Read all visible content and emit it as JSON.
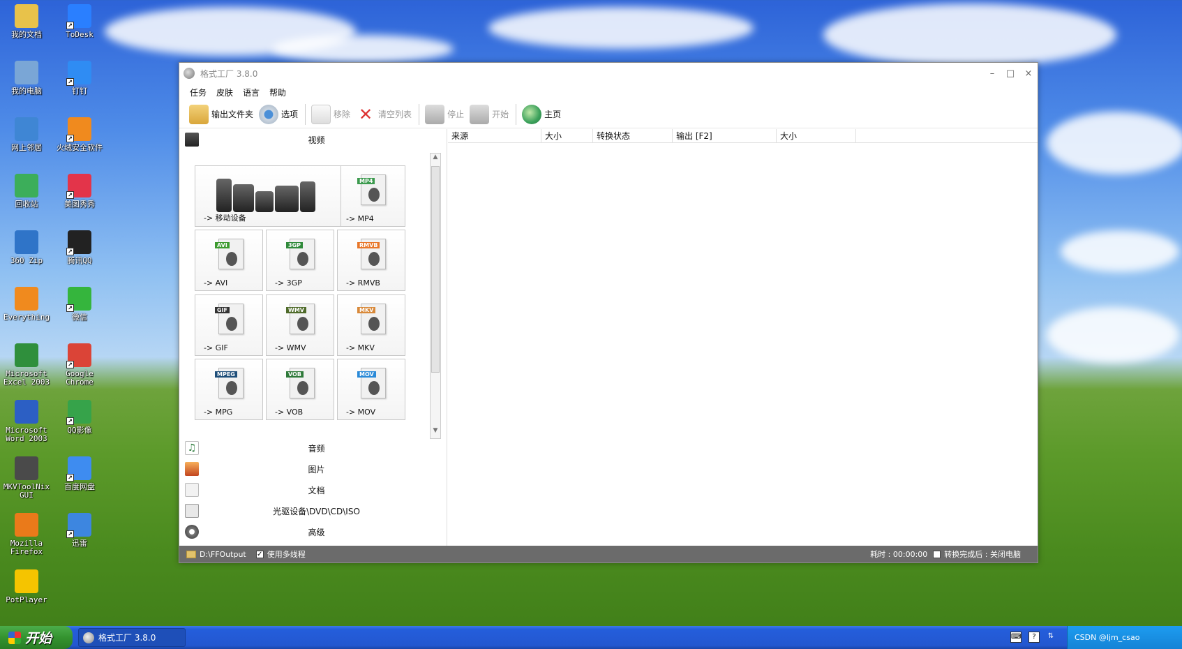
{
  "desktop": {
    "icons": [
      {
        "label": "我的文档",
        "color": "#e8c24a"
      },
      {
        "label": "ToDesk",
        "color": "#2a7fff"
      },
      {
        "label": "我的电脑",
        "color": "#7aa6d6"
      },
      {
        "label": "钉钉",
        "color": "#2f8cf3"
      },
      {
        "label": "网上邻居",
        "color": "#3f86d4"
      },
      {
        "label": "火绒安全软件",
        "color": "#f08a1e"
      },
      {
        "label": "回收站",
        "color": "#3cae5a"
      },
      {
        "label": "美图秀秀",
        "color": "#e3344a"
      },
      {
        "label": "360 Zip",
        "color": "#2f74c8"
      },
      {
        "label": "腾讯QQ",
        "color": "#222222"
      },
      {
        "label": "Everything",
        "color": "#f08a1e"
      },
      {
        "label": "微信",
        "color": "#35b53d"
      },
      {
        "label": "Microsoft\nExcel 2003",
        "color": "#2f8f3c"
      },
      {
        "label": "Google\nChrome",
        "color": "#db4437"
      },
      {
        "label": "Microsoft\nWord 2003",
        "color": "#2c5fc4"
      },
      {
        "label": "QQ影像",
        "color": "#36a34a"
      },
      {
        "label": "MKVToolNix\nGUI",
        "color": "#4a4a4a"
      },
      {
        "label": "百度网盘",
        "color": "#3e8cf0"
      },
      {
        "label": "Mozilla\nFirefox",
        "color": "#ea7a1a"
      },
      {
        "label": "迅雷",
        "color": "#3d86e0"
      },
      {
        "label": "PotPlayer",
        "color": "#f5c400"
      }
    ]
  },
  "window": {
    "title": "格式工厂 3.8.0",
    "controls": {
      "minimize": "–",
      "maximize": "□",
      "close": "×"
    },
    "menu": [
      "任务",
      "皮肤",
      "语言",
      "帮助"
    ],
    "toolbar": {
      "output_folder": "输出文件夹",
      "options": "选项",
      "remove": "移除",
      "clear_list": "清空列表",
      "stop": "停止",
      "start": "开始",
      "home": "主页"
    },
    "categories": {
      "video": "视频",
      "audio": "音频",
      "image": "图片",
      "document": "文档",
      "disc": "光驱设备\\DVD\\CD\\ISO",
      "advanced": "高级"
    },
    "formats": [
      {
        "label": "-> 移动设备",
        "tag": "",
        "tag_color": "#4a4a4a"
      },
      {
        "label": "-> MP4",
        "tag": "MP4",
        "tag_color": "#3c9a4e"
      },
      {
        "label": "-> AVI",
        "tag": "AVI",
        "tag_color": "#3c9a2e"
      },
      {
        "label": "-> 3GP",
        "tag": "3GP",
        "tag_color": "#2f8a3a"
      },
      {
        "label": "-> RMVB",
        "tag": "RMVB",
        "tag_color": "#e8772a"
      },
      {
        "label": "-> GIF",
        "tag": "GIF",
        "tag_color": "#333333"
      },
      {
        "label": "-> WMV",
        "tag": "WMV",
        "tag_color": "#4f6b2a"
      },
      {
        "label": "-> MKV",
        "tag": "MKV",
        "tag_color": "#d8893a"
      },
      {
        "label": "-> MPG",
        "tag": "MPEG",
        "tag_color": "#1f4f7a"
      },
      {
        "label": "-> VOB",
        "tag": "VOB",
        "tag_color": "#2f7a3a"
      },
      {
        "label": "-> MOV",
        "tag": "MOV",
        "tag_color": "#2a8ad8"
      }
    ],
    "table_headers": [
      "来源",
      "大小",
      "转换状态",
      "输出 [F2]",
      "大小"
    ],
    "status": {
      "output_path": "D:\\FFOutput",
      "multithread_label": "使用多线程",
      "elapsed": "耗时 : 00:00:00",
      "after_convert": "转换完成后 : 关闭电脑"
    }
  },
  "taskbar": {
    "start_label": "开始",
    "task_title": "格式工厂 3.8.0",
    "tray_text": "CSDN @ljm_csao"
  }
}
